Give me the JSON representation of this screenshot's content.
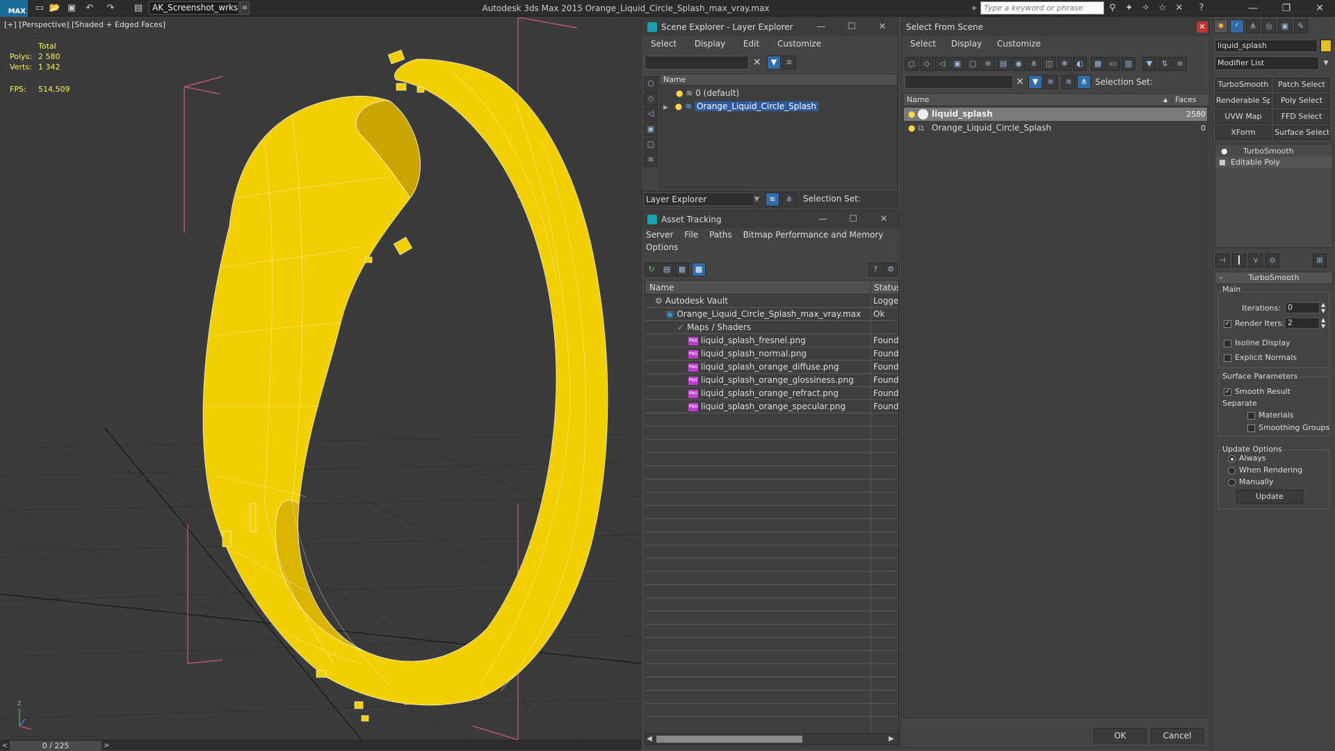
{
  "app": {
    "logo": "MAX",
    "workspace": "AK_Screenshot_wrksp",
    "title": "Autodesk 3ds Max  2015    Orange_Liquid_Circle_Splash_max_vray.max",
    "search_placeholder": "Type a keyword or phrase"
  },
  "viewport": {
    "label": "[+] [Perspective] [Shaded + Edged Faces]",
    "stats": {
      "total_label": "Total",
      "polys_label": "Polys:",
      "polys_value": "2 580",
      "verts_label": "Verts:",
      "verts_value": "1 342",
      "fps_label": "FPS:",
      "fps_value": "514,509"
    },
    "colors": {
      "mesh": "#f5d000",
      "wire": "#ffffff",
      "background": "#3b3b3b"
    }
  },
  "timeline": {
    "frame": "0 / 225",
    "prev": "<",
    "next": ">"
  },
  "scene_explorer": {
    "title": "Scene Explorer - Layer Explorer",
    "menu": [
      "Select",
      "Display",
      "Edit",
      "Customize"
    ],
    "column_name": "Name",
    "rows": [
      {
        "label": "0 (default)",
        "selected": false
      },
      {
        "label": "Orange_Liquid_Circle_Splash",
        "selected": true
      }
    ],
    "footer_combo": "Layer Explorer",
    "footer_selection_set": "Selection Set:"
  },
  "asset_tracking": {
    "title": "Asset Tracking",
    "menu": [
      "Server",
      "File",
      "Paths",
      "Bitmap Performance and Memory"
    ],
    "menu2": [
      "Options"
    ],
    "col_name": "Name",
    "col_status": "Status",
    "rows": [
      {
        "name": "Autodesk Vault",
        "status": "Logge",
        "indent": 0,
        "icon": "vault"
      },
      {
        "name": "Orange_Liquid_Circle_Splash_max_vray.max",
        "status": "Ok",
        "indent": 1,
        "icon": "max"
      },
      {
        "name": "Maps / Shaders",
        "status": "",
        "indent": 2,
        "icon": "maps"
      },
      {
        "name": "liquid_splash_fresnel.png",
        "status": "Found",
        "indent": 3,
        "icon": "png"
      },
      {
        "name": "liquid_splash_normal.png",
        "status": "Found",
        "indent": 3,
        "icon": "png"
      },
      {
        "name": "liquid_splash_orange_diffuse.png",
        "status": "Found",
        "indent": 3,
        "icon": "png"
      },
      {
        "name": "liquid_splash_orange_glossiness.png",
        "status": "Found",
        "indent": 3,
        "icon": "png"
      },
      {
        "name": "liquid_splash_orange_refract.png",
        "status": "Found",
        "indent": 3,
        "icon": "png"
      },
      {
        "name": "liquid_splash_orange_specular.png",
        "status": "Found",
        "indent": 3,
        "icon": "png"
      }
    ],
    "png_badge": "PNG"
  },
  "select_from_scene": {
    "title": "Select From Scene",
    "menu": [
      "Select",
      "Display",
      "Customize"
    ],
    "selection_set": "Selection Set:",
    "col_name": "Name",
    "col_faces": "Faces",
    "rows": [
      {
        "name": "liquid_splash",
        "faces": "2580",
        "selected": true
      },
      {
        "name": "Orange_Liquid_Circle_Splash",
        "faces": "0",
        "selected": false
      }
    ],
    "ok": "OK",
    "cancel": "Cancel"
  },
  "command_panel": {
    "object_name": "liquid_splash",
    "object_color": "#e8c020",
    "modifier_list": "Modifier List",
    "modifier_buttons": [
      "TurboSmooth",
      "Patch Select",
      "Renderable Spline",
      "Poly Select",
      "UVW Map",
      "FFD Select",
      "XForm",
      "Surface Select"
    ],
    "stack": [
      "TurboSmooth",
      "Editable Poly"
    ],
    "rollout_title": "TurboSmooth",
    "main_label": "Main",
    "iterations_label": "Iterations:",
    "iterations_value": "0",
    "render_iters_label": "Render Iters:",
    "render_iters_value": "2",
    "render_iters_checked": true,
    "isoline_label": "Isoline Display",
    "explicit_normals_label": "Explicit Normals",
    "surface_params_label": "Surface Parameters",
    "smooth_result_label": "Smooth Result",
    "separate_label": "Separate",
    "materials_label": "Materials",
    "smoothing_groups_label": "Smoothing Groups",
    "update_options_label": "Update Options",
    "always_label": "Always",
    "when_rendering_label": "When Rendering",
    "manually_label": "Manually",
    "update_button": "Update"
  }
}
